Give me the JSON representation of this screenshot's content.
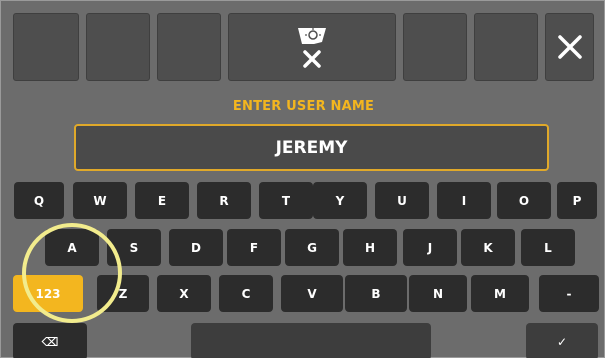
{
  "header": {
    "close_label": "✕",
    "badge_icon": "lightbulb-cancel-icon",
    "prompt": "ENTER USER NAME"
  },
  "input": {
    "value": "JEREMY"
  },
  "keyboard": {
    "row1": [
      "Q",
      "W",
      "E",
      "R",
      "T",
      "Y",
      "U",
      "I",
      "O",
      "P"
    ],
    "row2": [
      "A",
      "S",
      "D",
      "F",
      "G",
      "H",
      "J",
      "K",
      "L"
    ],
    "row3": [
      "123",
      "Z",
      "X",
      "C",
      "V",
      "B",
      "N",
      "M",
      "-"
    ],
    "row4": {
      "backspace": "⌫",
      "space": "",
      "enter": "✓"
    }
  },
  "colors": {
    "accent": "#f3b61f",
    "key_bg": "#2c2c2c",
    "panel_bg": "#6c6c6c",
    "highlight": "#f2ec8d"
  }
}
